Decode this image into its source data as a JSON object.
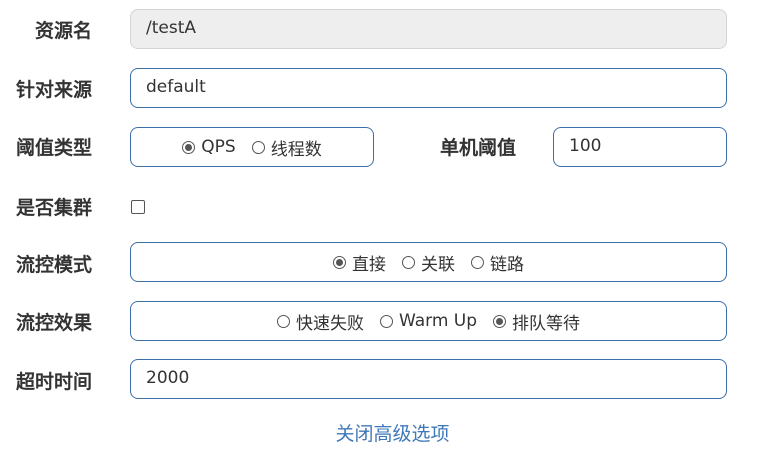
{
  "form": {
    "resource_name": {
      "label": "资源名",
      "value": "/testA"
    },
    "limit_app": {
      "label": "针对来源",
      "value": "default"
    },
    "threshold_type": {
      "label": "阈值类型",
      "options": [
        {
          "label": "QPS",
          "checked": true
        },
        {
          "label": "线程数",
          "checked": false
        }
      ]
    },
    "single_threshold": {
      "label": "单机阈值",
      "value": "100"
    },
    "cluster": {
      "label": "是否集群",
      "checked": false
    },
    "flow_mode": {
      "label": "流控模式",
      "options": [
        {
          "label": "直接",
          "checked": true
        },
        {
          "label": "关联",
          "checked": false
        },
        {
          "label": "链路",
          "checked": false
        }
      ]
    },
    "flow_effect": {
      "label": "流控效果",
      "options": [
        {
          "label": "快速失败",
          "checked": false
        },
        {
          "label": "Warm Up",
          "checked": false
        },
        {
          "label": "排队等待",
          "checked": true
        }
      ]
    },
    "timeout": {
      "label": "超时时间",
      "value": "2000"
    },
    "advanced_toggle": "关闭高级选项"
  }
}
